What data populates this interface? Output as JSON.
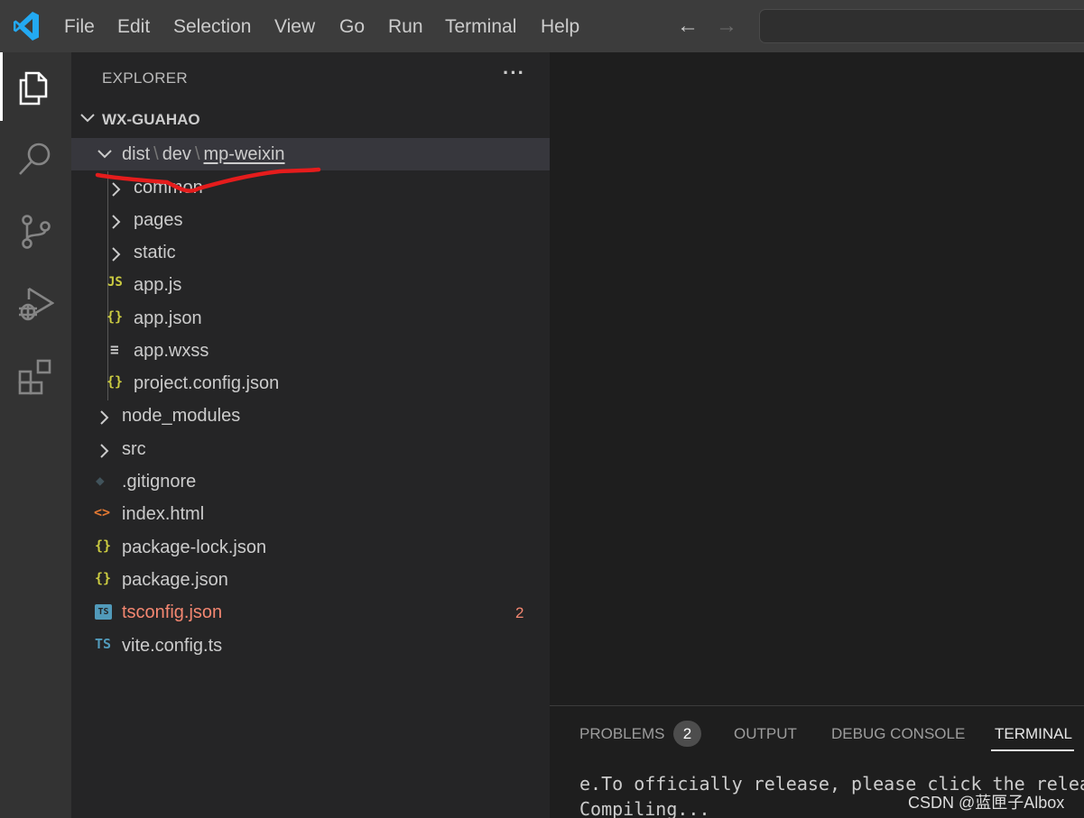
{
  "menu": [
    "File",
    "Edit",
    "Selection",
    "View",
    "Go",
    "Run",
    "Terminal",
    "Help"
  ],
  "navigation": {
    "back_icon": "arrow-left-icon",
    "forward_icon": "arrow-right-icon"
  },
  "activity_bar": [
    "explorer-icon",
    "search-icon",
    "source-control-icon",
    "run-debug-icon",
    "extensions-icon"
  ],
  "sidebar": {
    "title": "EXPLORER",
    "more_actions": "···",
    "workspace": "WX-GUAHAO",
    "compact_folder": {
      "segments": [
        "dist",
        "dev",
        "mp-weixin"
      ],
      "separator": "\\"
    },
    "items": [
      {
        "label": "common",
        "kind": "folder"
      },
      {
        "label": "pages",
        "kind": "folder"
      },
      {
        "label": "static",
        "kind": "folder"
      },
      {
        "label": "app.js",
        "kind": "js",
        "icon_text": "JS"
      },
      {
        "label": "app.json",
        "kind": "json",
        "icon_text": "{}"
      },
      {
        "label": "app.wxss",
        "kind": "css",
        "icon_text": "≡"
      },
      {
        "label": "project.config.json",
        "kind": "json",
        "icon_text": "{}"
      },
      {
        "label": "node_modules",
        "kind": "folder"
      },
      {
        "label": "src",
        "kind": "folder"
      },
      {
        "label": ".gitignore",
        "kind": "git",
        "icon_text": "◆"
      },
      {
        "label": "index.html",
        "kind": "html",
        "icon_text": "<>"
      },
      {
        "label": "package-lock.json",
        "kind": "json",
        "icon_text": "{}"
      },
      {
        "label": "package.json",
        "kind": "json",
        "icon_text": "{}"
      },
      {
        "label": "tsconfig.json",
        "kind": "tsconfig",
        "icon_text": "TS",
        "badge": "2"
      },
      {
        "label": "vite.config.ts",
        "kind": "ts",
        "icon_text": "TS"
      }
    ]
  },
  "panel": {
    "tabs": [
      "PROBLEMS",
      "OUTPUT",
      "DEBUG CONSOLE",
      "TERMINAL"
    ],
    "active_tab": "TERMINAL",
    "problems_count": "2",
    "terminal_lines": [
      "e.To officially release, please click the relea",
      "Compiling..."
    ]
  },
  "watermark": "CSDN @蓝匣子Albox",
  "colors": {
    "accent": "#007acc",
    "annotation_red": "#e51c1c",
    "json_icon": "#cbcb41",
    "js_icon": "#cbcb41",
    "html_icon": "#e37933",
    "ts_icon": "#519aba",
    "error_text": "#f48771"
  }
}
